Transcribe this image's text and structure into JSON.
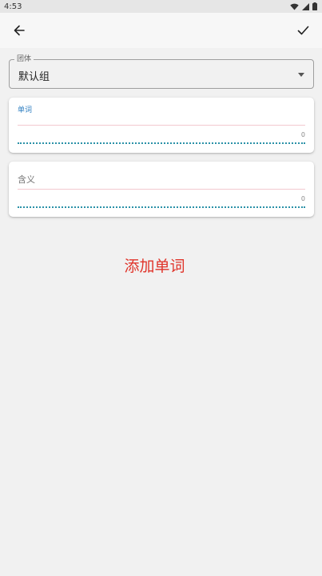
{
  "status_bar": {
    "time": "4:53"
  },
  "group_field": {
    "legend": "团体",
    "value": "默认组"
  },
  "word_field": {
    "label": "单词",
    "value": "",
    "counter": "0"
  },
  "meaning_field": {
    "hint": "含义",
    "value": "",
    "counter": "0"
  },
  "actions": {
    "add_word": "添加单词"
  },
  "colors": {
    "accent": "#2f7fc1",
    "action_red": "#e0342a",
    "dotted": "#2a91a8"
  },
  "icons": {
    "back": "arrow-left-icon",
    "confirm": "checkmark-icon",
    "dropdown": "caret-down-icon"
  }
}
